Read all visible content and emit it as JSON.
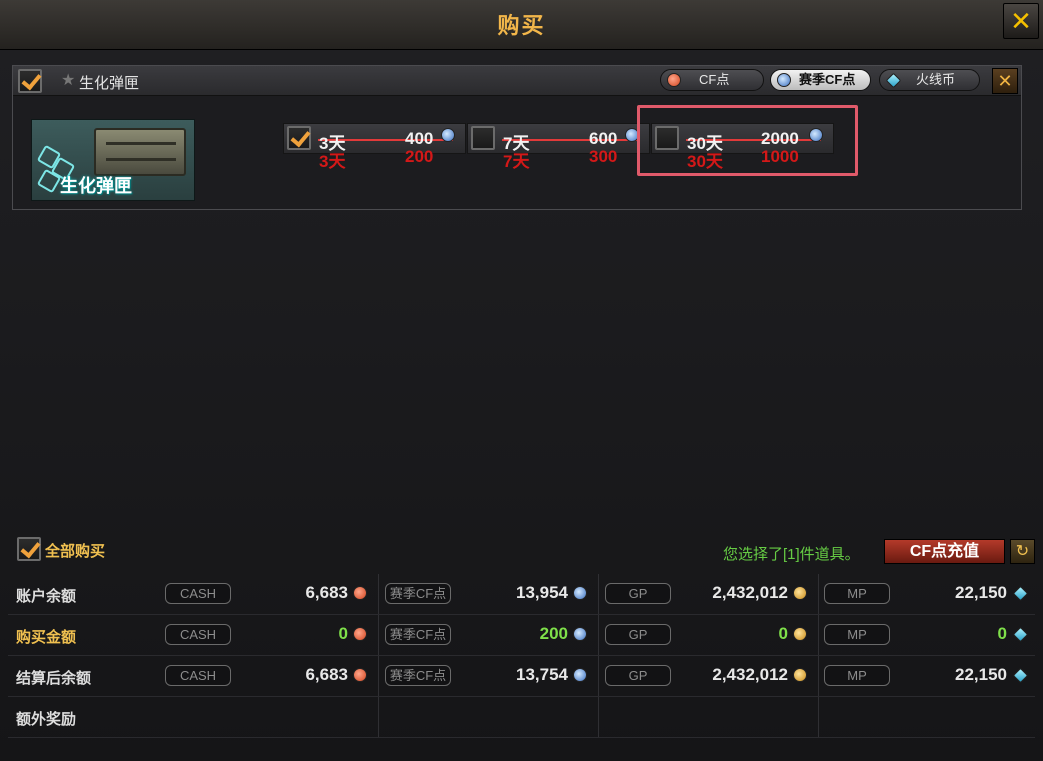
{
  "window": {
    "title": "购买",
    "close_label": "✕"
  },
  "item": {
    "name": "生化弹匣",
    "image_label": "生化弹匣",
    "currency_tabs": [
      {
        "label": "CF点",
        "icon": "red-coin-icon",
        "active": false
      },
      {
        "label": "赛季CF点",
        "icon": "blue-coin-icon",
        "active": true
      },
      {
        "label": "火线币",
        "icon": "diamond-icon",
        "active": false
      }
    ],
    "close_label": "✕",
    "durations": [
      {
        "days": "3天",
        "price": "400",
        "sale_days": "3天",
        "sale_price": "200",
        "checked": true
      },
      {
        "days": "7天",
        "price": "600",
        "sale_days": "7天",
        "sale_price": "300",
        "checked": false
      },
      {
        "days": "30天",
        "price": "2000",
        "sale_days": "30天",
        "sale_price": "1000",
        "checked": false
      }
    ]
  },
  "footer": {
    "all_buy_label": "全部购买",
    "selected_msg": "您选择了[1]件道具。",
    "recharge_label": "CF点充值",
    "refresh_icon": "refresh-icon"
  },
  "table": {
    "rows": [
      {
        "label": "账户余额",
        "cash": "6,683",
        "season": "13,954",
        "gp": "2,432,012",
        "mp": "22,150"
      },
      {
        "label": "购买金额",
        "cash": "0",
        "season": "200",
        "gp": "0",
        "mp": "0"
      },
      {
        "label": "结算后余额",
        "cash": "6,683",
        "season": "13,754",
        "gp": "2,432,012",
        "mp": "22,150"
      },
      {
        "label": "额外奖励"
      }
    ],
    "pill_labels": {
      "cash": "CASH",
      "season": "赛季CF点",
      "gp": "GP",
      "mp": "MP"
    }
  }
}
